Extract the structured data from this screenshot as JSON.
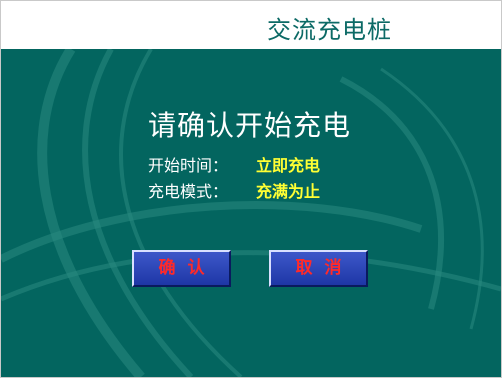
{
  "header": {
    "title": "交流充电桩"
  },
  "dialog": {
    "heading": "请确认开始充电",
    "rows": [
      {
        "label": "开始时间：",
        "value": "立即充电"
      },
      {
        "label": "充电模式：",
        "value": "充满为止"
      }
    ]
  },
  "buttons": {
    "confirm": "确认",
    "cancel": "取消"
  },
  "colors": {
    "panel": "#03655f",
    "value_text": "#ffff33",
    "button_face": "#2a45b8",
    "button_text": "#ff2a2a"
  }
}
